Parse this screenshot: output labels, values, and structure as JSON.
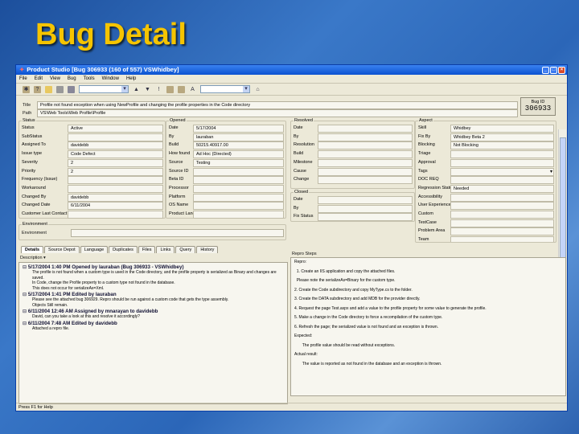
{
  "slide_title": "Bug Detail",
  "window": {
    "title": "Product Studio   [Bug 306933   (160 of 557) VSWhidbey]"
  },
  "menu": [
    "File",
    "Edit",
    "View",
    "Bug",
    "Tools",
    "Window",
    "Help"
  ],
  "toolbar": {
    "icons": [
      "new-bug-icon",
      "new-query-icon",
      "open-icon",
      "save-icon",
      "print-icon",
      "prev-icon",
      "next-icon",
      "help-icon",
      "copy-icon",
      "paste-icon",
      "font-icon",
      "home-icon"
    ]
  },
  "title_field": {
    "label": "Title",
    "value": "Profile not found exception when using NewProfile and changing the profile properties in the Code directory"
  },
  "path_field": {
    "label": "Path",
    "value": "VS\\Web Tools\\Web Profile\\Profile"
  },
  "bug_id": {
    "label": "Bug ID",
    "value": "306933"
  },
  "status_group": {
    "title": "Status",
    "fields": [
      {
        "label": "Status",
        "value": "Active"
      },
      {
        "label": "SubStatus",
        "value": ""
      },
      {
        "label": "Assigned To",
        "value": "davidebb"
      },
      {
        "label": "Issue type",
        "value": "Code Defect"
      },
      {
        "label": "Severity",
        "value": "2"
      },
      {
        "label": "Priority",
        "value": "2"
      },
      {
        "label": "Frequency (Issue)",
        "value": ""
      },
      {
        "label": "Workaround",
        "value": ""
      },
      {
        "label": "Changed By",
        "value": "davidebb"
      },
      {
        "label": "Changed Date",
        "value": "6/11/2004"
      },
      {
        "label": "Customer Last Contact",
        "value": ""
      }
    ]
  },
  "opened_group": {
    "title": "Opened",
    "fields": [
      {
        "label": "Date",
        "value": "5/17/2004"
      },
      {
        "label": "By",
        "value": "lauraban"
      },
      {
        "label": "Build",
        "value": "50215.40917.00"
      },
      {
        "label": "How found",
        "value": "Ad Hoc (Directed)"
      },
      {
        "label": "Source",
        "value": "Testing"
      },
      {
        "label": "Source ID",
        "value": ""
      },
      {
        "label": "Beta ID",
        "value": ""
      },
      {
        "label": "Processor",
        "value": ""
      },
      {
        "label": "Platform",
        "value": ""
      },
      {
        "label": "OS Name",
        "value": ""
      },
      {
        "label": "Product Lang",
        "value": ""
      }
    ]
  },
  "resolved_group": {
    "title": "Resolved",
    "fields": [
      {
        "label": "Date",
        "value": ""
      },
      {
        "label": "By",
        "value": ""
      },
      {
        "label": "Resolution",
        "value": ""
      },
      {
        "label": "Build",
        "value": ""
      },
      {
        "label": "Milestone",
        "value": ""
      },
      {
        "label": "Cause",
        "value": ""
      },
      {
        "label": "Change",
        "value": ""
      }
    ]
  },
  "closed_group": {
    "title": "Closed",
    "fields": [
      {
        "label": "Date",
        "value": ""
      },
      {
        "label": "By",
        "value": ""
      },
      {
        "label": "Fix Status",
        "value": ""
      }
    ]
  },
  "aspect_group": {
    "title": "Aspect",
    "fields": [
      {
        "label": "Skill",
        "value": "Whidbey"
      },
      {
        "label": "Fix By",
        "value": "Whidbey Beta 2"
      },
      {
        "label": "Blocking",
        "value": "Not Blocking"
      },
      {
        "label": "Triage",
        "value": ""
      },
      {
        "label": "Approval",
        "value": ""
      },
      {
        "label": "Tags",
        "value": ""
      },
      {
        "label": "DOC REQ",
        "value": ""
      },
      {
        "label": "Regression Status",
        "value": "Needed"
      },
      {
        "label": "Accessibility",
        "value": ""
      },
      {
        "label": "User Experience",
        "value": ""
      },
      {
        "label": "Custom",
        "value": ""
      },
      {
        "label": "TestCase",
        "value": ""
      },
      {
        "label": "Problem Area",
        "value": ""
      },
      {
        "label": "Team",
        "value": ""
      }
    ]
  },
  "environment": {
    "title": "Environment",
    "label": "Environment",
    "value": ""
  },
  "tabs": [
    "Details",
    "Source Depot",
    "Language",
    "Duplicates",
    "Files",
    "Links",
    "Query",
    "History"
  ],
  "description": {
    "label": "Description",
    "entries": [
      {
        "header": "5/17/2004 1:40 PM  Opened by lauraban (Bug 306933 - VSWhidbey)",
        "body": [
          "The profile is not found when a custom type is used in the Code directory, and the profile property is serialized as Binary and changes are saved.",
          "In Code, change the Profile property to a custom type not found in the database.",
          "This does not occur for serializeAs=Xml."
        ]
      },
      {
        "header": "5/17/2004 1:41 PM  Edited by lauraban",
        "body": [
          "Please see the attached bug 306929. Repro should be run against a custom code that gets the type assembly.",
          "Objects Still remain."
        ]
      },
      {
        "header": "6/11/2004 12:46 AM Assigned by mnarayan to davidebb",
        "body": [
          "David, can you take a look at this and resolve it accordingly?"
        ]
      },
      {
        "header": "6/11/2004 7:48 AM  Edited by davidebb",
        "body": [
          "Attached a repro file."
        ]
      }
    ]
  },
  "repro": {
    "label": "Repro Steps",
    "lines": [
      "Repro:",
      "  1. Create an IIS application and copy the attached files.",
      "  Please note the serializeAs=Binary for the custom type.",
      "2. Create the Code subdirectory and copy MyType.cs to the folder.",
      "3. Create the DATA subdirectory and add MDB for the provider directly.",
      "4. Request the page Test.aspx and add a value to the profile property for some value to generate the profile.",
      "5. Make a change in the Code directory to force a recompilation of the custom type.",
      "6. Refresh the page; the serialized value is not found and an exception is thrown.",
      "Expected:",
      "       The profile value should be read without exceptions.",
      "Actual result:",
      "       The value is reported as not found in the database and an exception is thrown."
    ]
  },
  "status_bar": "Press F1 for Help"
}
